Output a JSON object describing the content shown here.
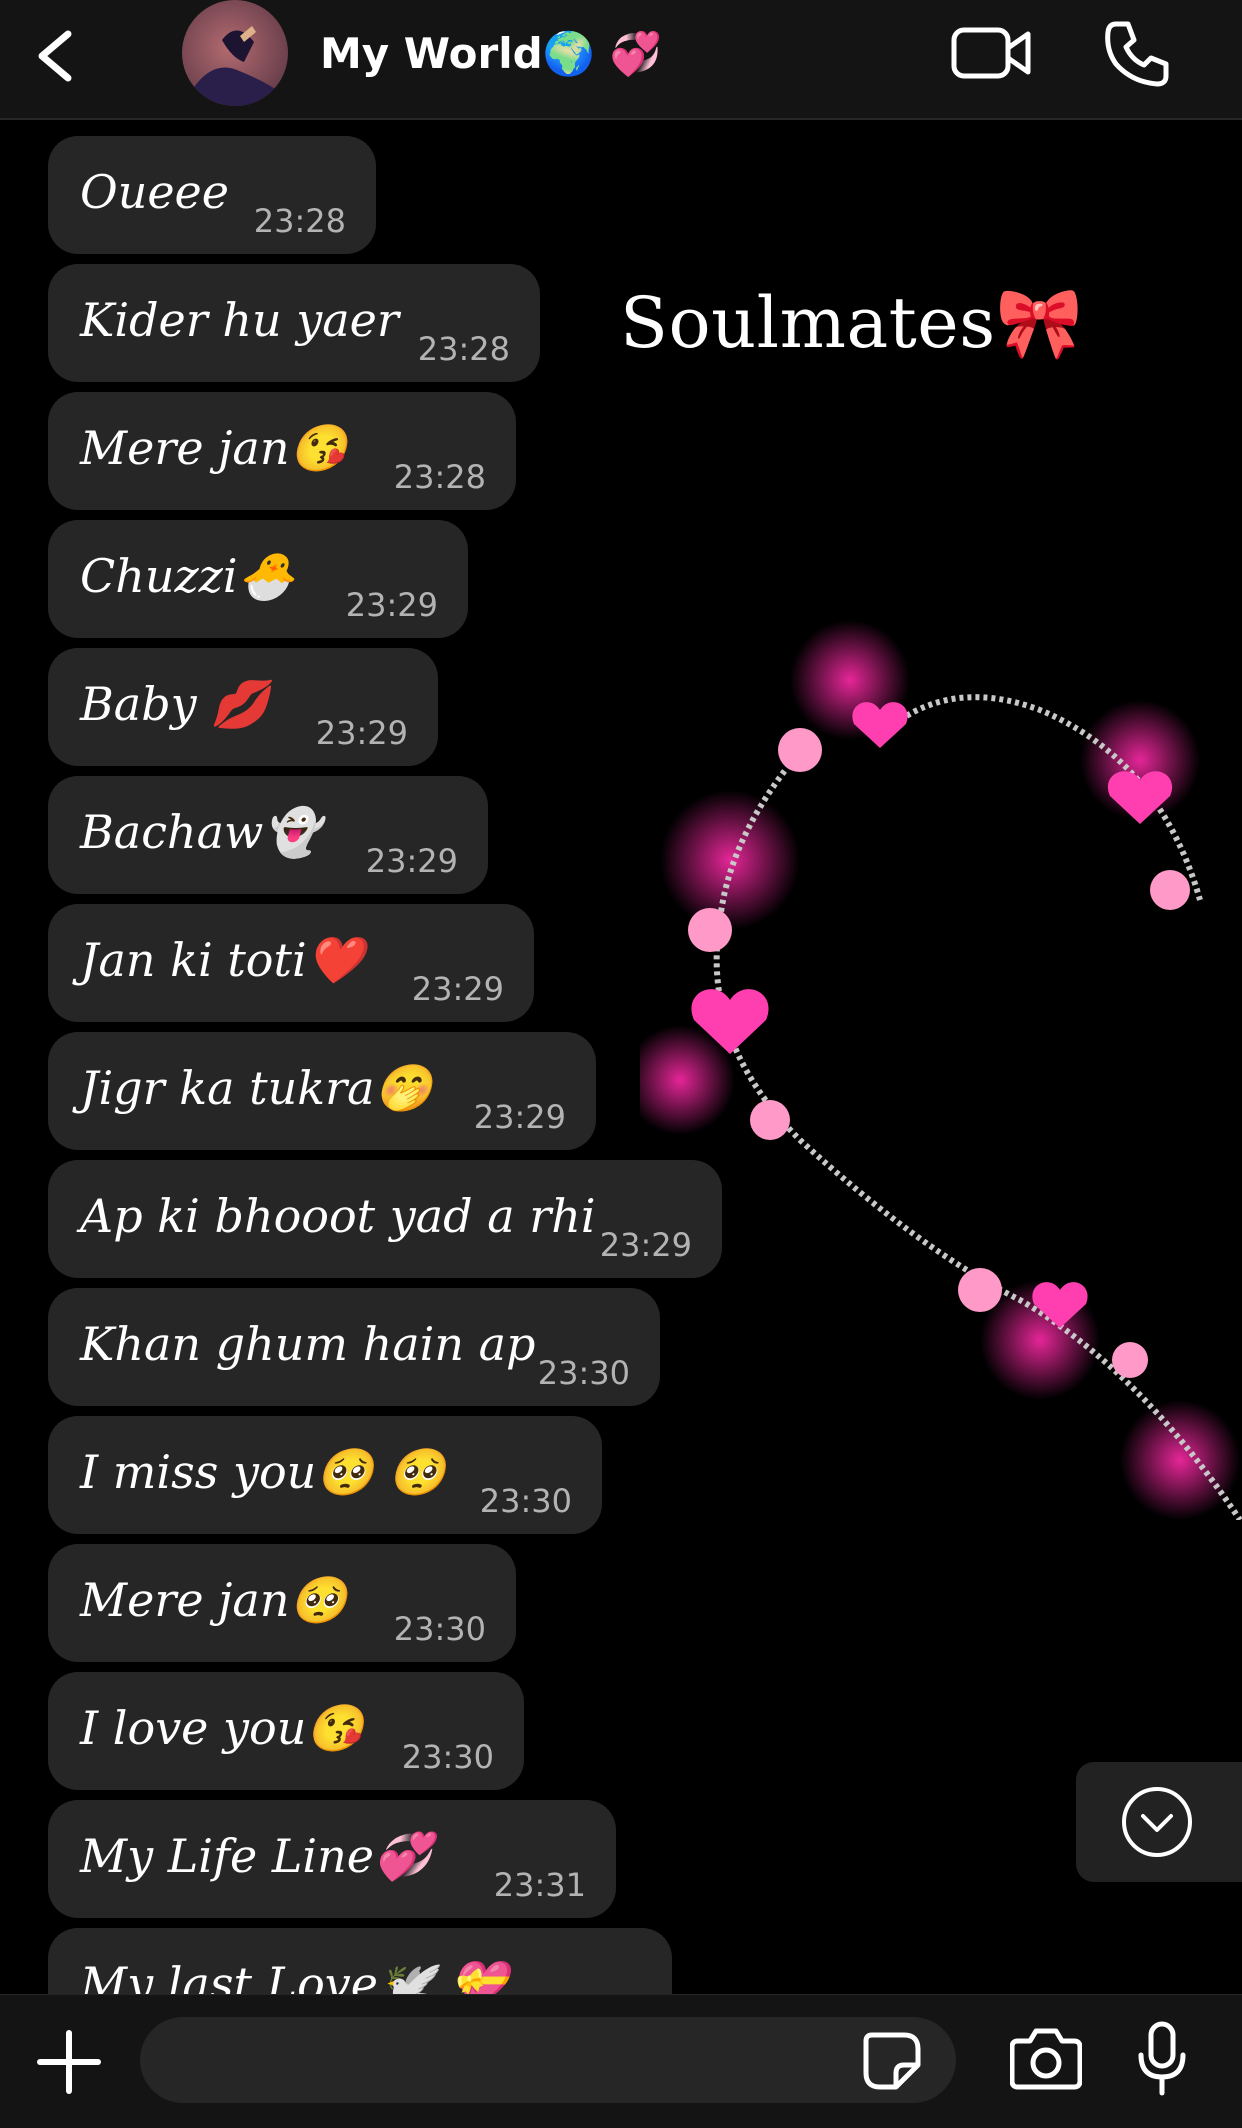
{
  "header": {
    "title": "My World🌍 💞",
    "back_icon": "back-chevron-icon",
    "video_icon": "video-camera-icon",
    "call_icon": "phone-icon"
  },
  "wallpaper": {
    "caption": "Soulmates🎀"
  },
  "messages": [
    {
      "text": "Oueee",
      "time": "23:28"
    },
    {
      "text": "Kider hu yaer",
      "time": "23:28"
    },
    {
      "text": "Mere jan😘",
      "time": "23:28"
    },
    {
      "text": "Chuzzi🐣",
      "time": "23:29"
    },
    {
      "text": "Baby 💋",
      "time": "23:29"
    },
    {
      "text": "Bachaw👻",
      "time": "23:29"
    },
    {
      "text": "Jan ki toti❤️",
      "time": "23:29"
    },
    {
      "text": "Jigr ka tukra🤭",
      "time": "23:29"
    },
    {
      "text": "Ap ki bhooot yad a rhi",
      "time": "23:29"
    },
    {
      "text": "Khan ghum hain ap",
      "time": "23:30"
    },
    {
      "text": "I miss you🥺 🥺",
      "time": "23:30"
    },
    {
      "text": "Mere jan🥺",
      "time": "23:30"
    },
    {
      "text": "I love you😘",
      "time": "23:30"
    },
    {
      "text": "My Life Line💞",
      "time": "23:31"
    },
    {
      "text": "My last Love🕊️ 💝",
      "time": ""
    }
  ],
  "composer": {
    "placeholder": "",
    "value": ""
  },
  "colors": {
    "background": "#000000",
    "bubble": "#262626",
    "bar": "#141414",
    "timestamp": "#b3b3b3"
  }
}
